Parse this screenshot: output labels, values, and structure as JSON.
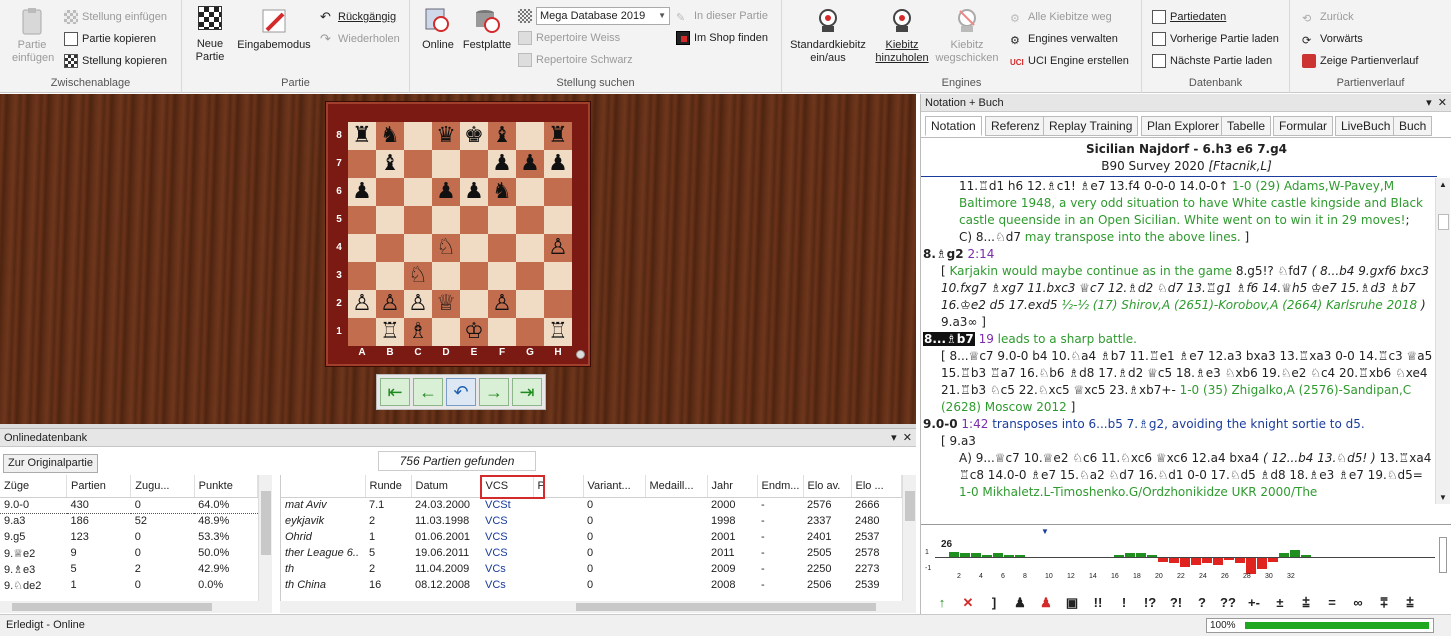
{
  "ribbon": {
    "clipboard": {
      "group": "Zwischenablage",
      "paste": "Partie\neinfügen",
      "stellung_einfuegen": "Stellung einfügen",
      "partie_kopieren": "Partie kopieren",
      "stellung_kopieren": "Stellung kopieren"
    },
    "partie": {
      "group": "Partie",
      "neue": "Neue\nPartie",
      "eingabemodus": "Eingabemodus",
      "rueckgaengig": "Rückgängig",
      "wiederholen": "Wiederholen"
    },
    "suchen": {
      "group": "Stellung suchen",
      "online": "Online",
      "festplatte": "Festplatte",
      "database": "Mega Database 2019",
      "in_dieser_partie": "In dieser Partie",
      "im_shop": "Im Shop finden",
      "rep_weiss": "Repertoire Weiss",
      "rep_schwarz": "Repertoire Schwarz"
    },
    "engines": {
      "group": "Engines",
      "standard": "Standardkiebitz\nein/aus",
      "hinzu": "Kiebitz\nhinzuholen",
      "weg": "Kiebitz\nwegschicken",
      "alle_weg": "Alle Kiebitze weg",
      "verwalten": "Engines verwalten",
      "uci": "UCI Engine erstellen"
    },
    "datenbank": {
      "group": "Datenbank",
      "partiedaten": "Partiedaten",
      "vorherige": "Vorherige Partie laden",
      "naechste": "Nächste Partie laden"
    },
    "verlauf": {
      "group": "Partienverlauf",
      "zurueck": "Zurück",
      "vorwaerts": "Vorwärts",
      "zeige": "Zeige Partienverlauf"
    }
  },
  "board": {
    "files": [
      "A",
      "B",
      "C",
      "D",
      "E",
      "F",
      "G",
      "H"
    ],
    "ranks": [
      "8",
      "7",
      "6",
      "5",
      "4",
      "3",
      "2",
      "1"
    ],
    "position": [
      [
        "♜",
        "♞",
        "",
        "♛",
        "♚",
        "♝",
        "",
        "♜"
      ],
      [
        "",
        "♝",
        "",
        "",
        "",
        "♟",
        "♟",
        "♟"
      ],
      [
        "♟",
        "",
        "",
        "♟",
        "♟",
        "♞",
        "",
        ""
      ],
      [
        "",
        "",
        "",
        "",
        "",
        "",
        "",
        ""
      ],
      [
        "",
        "",
        "",
        "♘",
        "",
        "",
        "",
        "♙"
      ],
      [
        "",
        "",
        "♘",
        "",
        "",
        "",
        "",
        ""
      ],
      [
        "♙",
        "♙",
        "♙",
        "♕",
        "",
        "♙",
        "",
        ""
      ],
      [
        "",
        "♖",
        "♗",
        "",
        "♔",
        "",
        "",
        "♖"
      ]
    ]
  },
  "nav": [
    "⇤",
    "←",
    "↶",
    "→",
    "⇥"
  ],
  "onlinedb": {
    "title": "Onlinedatenbank",
    "btn": "Zur Originalpartie",
    "found": "756 Partien gefunden",
    "left_cols": [
      "Züge",
      "Partien",
      "Zugu...",
      "Punkte"
    ],
    "left_rows": [
      [
        "9.0-0",
        "430",
        "0",
        "64.0%"
      ],
      [
        "9.a3",
        "186",
        "52",
        "48.9%"
      ],
      [
        "9.g5",
        "123",
        "0",
        "53.3%"
      ],
      [
        "9.♕e2",
        "9",
        "0",
        "50.0%"
      ],
      [
        "9.♗e3",
        "5",
        "2",
        "42.9%"
      ],
      [
        "9.♘de2",
        "1",
        "0",
        "0.0%"
      ]
    ],
    "right_cols": [
      "",
      "Runde",
      "Datum",
      "VCS",
      "P",
      "Variant...",
      "Medaill...",
      "Jahr",
      "Endm...",
      "Elo av.",
      "Elo ..."
    ],
    "right_rows": [
      [
        "mat Aviv",
        "7.1",
        "24.03.2000",
        "VCSt",
        "",
        "0",
        "",
        "2000",
        "-",
        "2576",
        "2666"
      ],
      [
        "eykjavik",
        "2",
        "11.03.1998",
        "VCS",
        "",
        "0",
        "",
        "1998",
        "-",
        "2337",
        "2480"
      ],
      [
        "Ohrid",
        "1",
        "01.06.2001",
        "VCS",
        "",
        "0",
        "",
        "2001",
        "-",
        "2401",
        "2537"
      ],
      [
        "ther League 6..",
        "5",
        "19.06.2011",
        "VCS",
        "",
        "0",
        "",
        "2011",
        "-",
        "2505",
        "2578"
      ],
      [
        "th",
        "2",
        "11.04.2009",
        "VCs",
        "",
        "0",
        "",
        "2009",
        "-",
        "2250",
        "2273"
      ],
      [
        "th China",
        "16",
        "08.12.2008",
        "VCs",
        "",
        "0",
        "",
        "2008",
        "-",
        "2506",
        "2539"
      ]
    ]
  },
  "status": {
    "text": "Erledigt - Online",
    "zoom": "100%"
  },
  "right": {
    "title": "Notation + Buch",
    "tabs": [
      "Notation",
      "Referenz",
      "Replay Training",
      "Plan Explorer",
      "Tabelle",
      "Formular",
      "LiveBuch",
      "Buch"
    ],
    "opening": "Sicilian Najdorf - 6.h3 e6 7.g4",
    "survey": "B90 Survey 2020",
    "author": "[Ftacnik,L]"
  },
  "eval": {
    "label": "26",
    "ticks": [
      "2",
      "4",
      "6",
      "8",
      "10",
      "12",
      "14",
      "16",
      "18",
      "20",
      "22",
      "24",
      "26",
      "28",
      "30",
      "32"
    ],
    "values": [
      0.3,
      0.2,
      0.2,
      0.1,
      0.2,
      0.1,
      0.1,
      0,
      0,
      0,
      0,
      0,
      0,
      0,
      0,
      0.1,
      0.2,
      0.2,
      0.1,
      -0.2,
      -0.3,
      -0.5,
      -0.4,
      -0.3,
      -0.4,
      -0.1,
      -0.3,
      -0.9,
      -0.6,
      -0.2,
      0.2,
      0.4,
      0.1
    ],
    "symbols": [
      "↑",
      "✕",
      "]",
      "♟",
      "♟",
      "▣",
      "!!",
      "!",
      "!?",
      "?!",
      "?",
      "??",
      "+-",
      "±",
      "⩲",
      "=",
      "∞",
      "⩱",
      "⩲"
    ]
  },
  "colors": {
    "green": "#2f9a2f",
    "purple": "#7a2cab",
    "blue": "#1a3c9c",
    "highlight": "#d32b2b"
  }
}
